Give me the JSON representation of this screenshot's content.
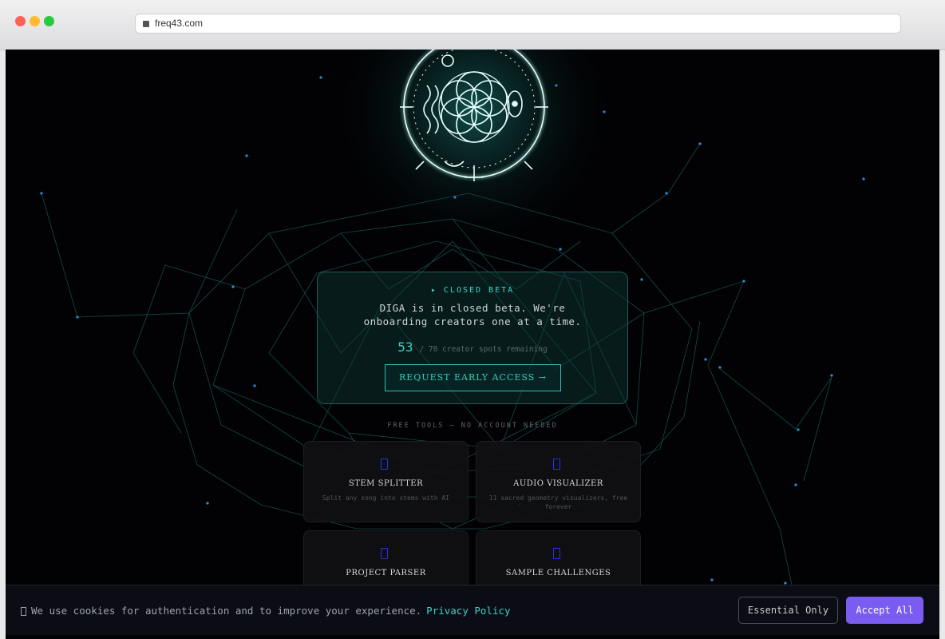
{
  "browser": {
    "url": "freq43.com"
  },
  "beta": {
    "tag": "▸ CLOSED BETA",
    "description": "DIGA is in closed beta. We're onboarding creators one at a time.",
    "spots_count": "53",
    "spots_text": "/ 70 creator spots remaining",
    "cta_label": "REQUEST EARLY ACCESS →"
  },
  "free_tools": {
    "label": "FREE TOOLS — NO ACCOUNT NEEDED",
    "items": [
      {
        "name": "STEM SPLITTER",
        "description": "Split any song into stems with AI",
        "icon": "tool-icon"
      },
      {
        "name": "AUDIO VISUALIZER",
        "description": "11 sacred geometry visualizers, free forever",
        "icon": "tool-icon"
      },
      {
        "name": "PROJECT PARSER",
        "description": "",
        "icon": "tool-icon"
      },
      {
        "name": "SAMPLE CHALLENGES",
        "description": "",
        "icon": "tool-icon"
      }
    ]
  },
  "cookie": {
    "text": "We use cookies for authentication and to improve your experience.",
    "policy_link": "Privacy Policy",
    "essential_label": "Essential Only",
    "accept_label": "Accept All"
  },
  "colors": {
    "accent_teal": "#33d4c4",
    "accent_purple": "#7b5cf0",
    "background": "#020204"
  }
}
